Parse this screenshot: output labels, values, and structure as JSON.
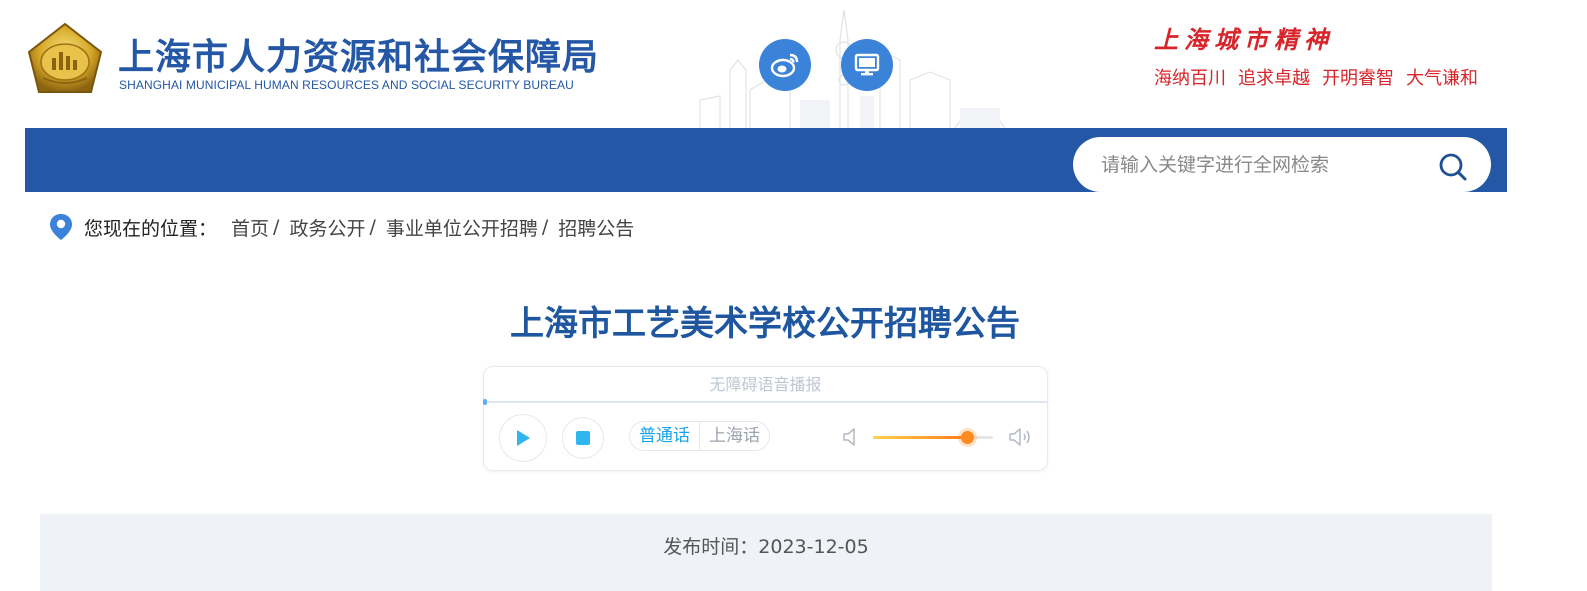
{
  "header": {
    "site_title": "上海市人力资源和社会保障局",
    "site_subtitle": "SHANGHAI MUNICIPAL HUMAN RESOURCES AND SOCIAL SECURITY BUREAU",
    "icons": [
      "weibo-icon",
      "desktop-icon"
    ],
    "spirit": {
      "title": "上海城市精神",
      "phrases": [
        "海纳百川",
        "追求卓越",
        "开明睿智",
        "大气谦和"
      ]
    }
  },
  "search": {
    "placeholder": "请输入关键字进行全网检索"
  },
  "breadcrumb": {
    "label": "您现在的位置：",
    "items": [
      "首页",
      "政务公开",
      "事业单位公开招聘",
      "招聘公告"
    ],
    "separator": "/"
  },
  "article": {
    "title": "上海市工艺美术学校公开招聘公告",
    "publish": {
      "label": "发布时间：",
      "date": "2023-12-05"
    }
  },
  "player": {
    "title": "无障碍语音播报",
    "languages": [
      "普通话",
      "上海话"
    ],
    "active_language": "普通话",
    "volume_fraction": 0.78
  },
  "colors": {
    "brand_blue": "#2457a5",
    "spirit_red": "#d7252b",
    "accent_cyan": "#1aa3e8",
    "volume_orange": "#ff8a1f"
  }
}
